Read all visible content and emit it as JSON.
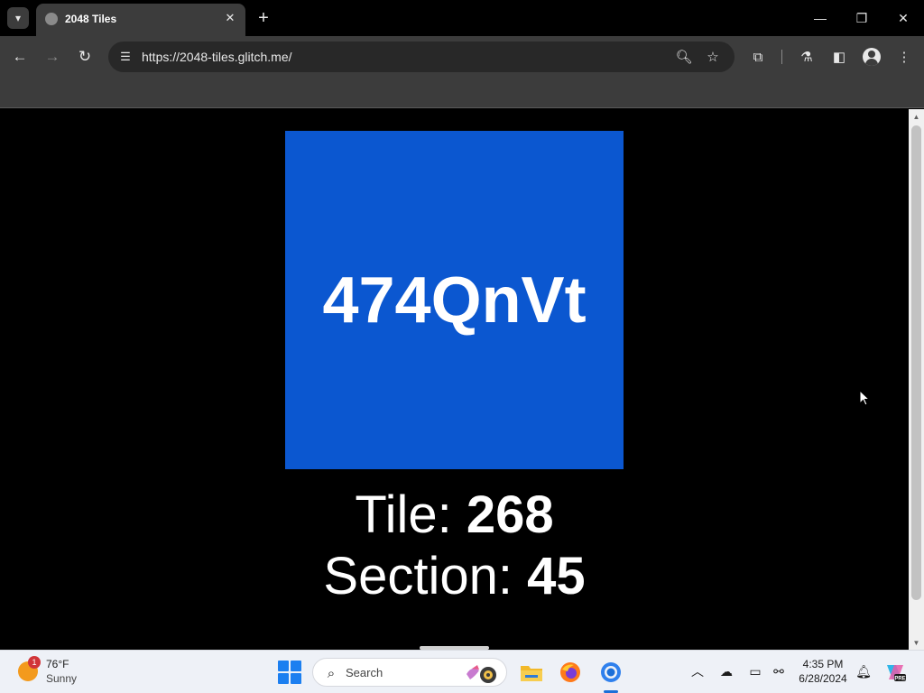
{
  "browser": {
    "tab_title": "2048 Tiles",
    "url": "https://2048-tiles.glitch.me/"
  },
  "page": {
    "tile_text": "474QnVt",
    "tile_color": "#0b57d0",
    "tile_label": "Tile:",
    "tile_number": "268",
    "section_label": "Section:",
    "section_number": "45"
  },
  "taskbar": {
    "weather_temp": "76°F",
    "weather_condition": "Sunny",
    "weather_badge": "1",
    "search_placeholder": "Search",
    "clock_time": "4:35 PM",
    "clock_date": "6/28/2024"
  }
}
